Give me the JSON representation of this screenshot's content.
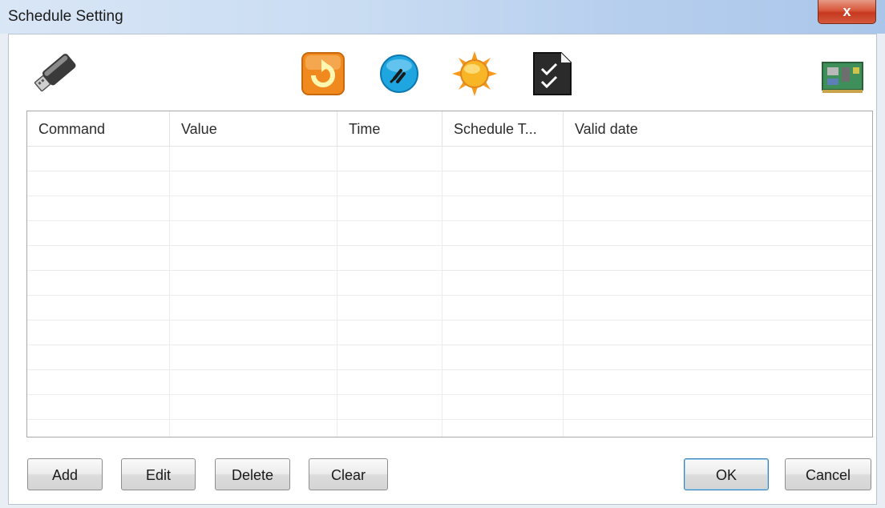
{
  "window": {
    "title": "Schedule Setting",
    "close_glyph": "x"
  },
  "toolbar": {
    "icons": [
      {
        "name": "usb-drive-icon"
      },
      {
        "name": "refresh-icon"
      },
      {
        "name": "power-plug-icon"
      },
      {
        "name": "sun-icon"
      },
      {
        "name": "checklist-document-icon"
      },
      {
        "name": "board-card-icon"
      }
    ]
  },
  "table": {
    "columns": [
      "Command",
      "Value",
      "Time",
      "Schedule T...",
      "Valid date"
    ],
    "rows": []
  },
  "buttons": {
    "add": "Add",
    "edit": "Edit",
    "delete": "Delete",
    "clear": "Clear",
    "ok": "OK",
    "cancel": "Cancel"
  },
  "colors": {
    "titlebar": "#c9dcf2",
    "close": "#d04a2f",
    "default_button_border": "#3c7fb1"
  }
}
